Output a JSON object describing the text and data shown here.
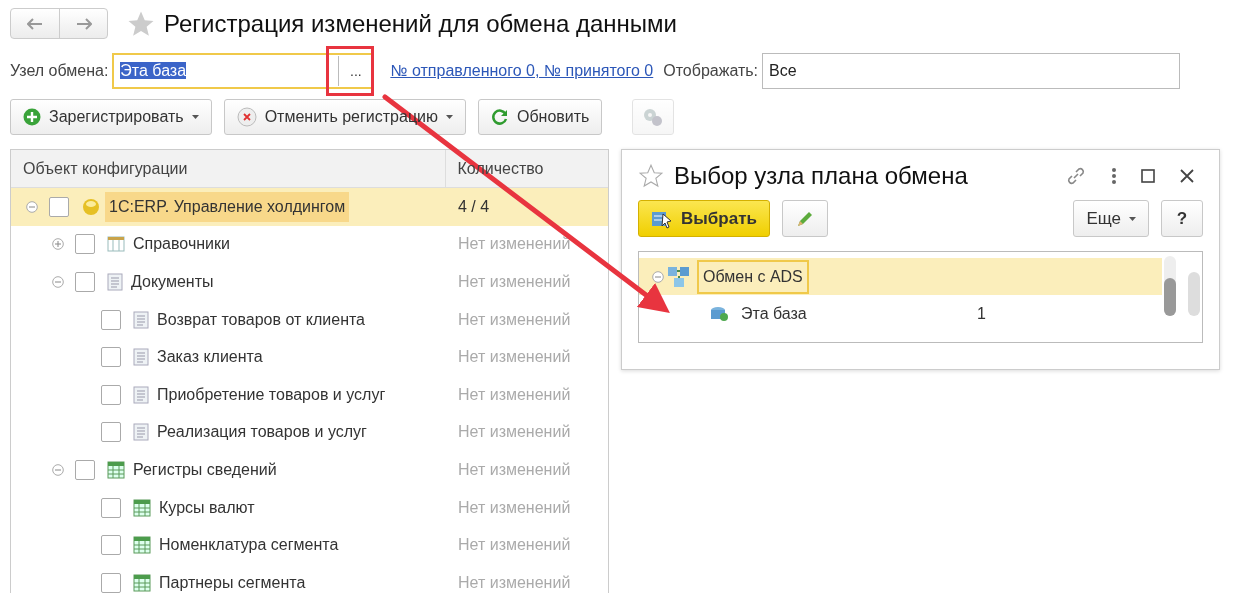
{
  "window": {
    "title": "Регистрация изменений для обмена данными",
    "favorite": false
  },
  "node_field": {
    "label": "Узел обмена:",
    "value": "Эта база",
    "select_button": "..."
  },
  "counters_link": "№ отправленного 0, № принятого 0",
  "display_field": {
    "label": "Отображать:",
    "value": "Все"
  },
  "toolbar": [
    {
      "kind": "register",
      "label": "Зарегистрировать",
      "dropdown": true,
      "disabled": false
    },
    {
      "kind": "unregister",
      "label": "Отменить регистрацию",
      "dropdown": true,
      "disabled": false
    },
    {
      "kind": "refresh",
      "label": "Обновить",
      "dropdown": false,
      "disabled": false
    },
    {
      "kind": "settings",
      "dropdown": false,
      "disabled": true
    }
  ],
  "table": {
    "columns": [
      "Объект конфигурации",
      "Количество"
    ],
    "rows": [
      {
        "kind": "root",
        "label": "1C:ERP. Управление холдингом",
        "count": "4 / 4",
        "checked": false,
        "selected": true,
        "expanded": true,
        "children": [
          {
            "kind": "catalog",
            "label": "Справочники",
            "count": "Нет изменений",
            "checked": false,
            "selected": false,
            "expanded": false
          },
          {
            "kind": "document",
            "label": "Документы",
            "count": "Нет изменений",
            "checked": false,
            "selected": false,
            "expanded": true,
            "children": [
              {
                "kind": "document",
                "label": "Возврат товаров от клиента",
                "count": "Нет изменений",
                "checked": false,
                "selected": false
              },
              {
                "kind": "document",
                "label": "Заказ клиента",
                "count": "Нет изменений",
                "checked": false,
                "selected": false
              },
              {
                "kind": "document",
                "label": "Приобретение товаров и услуг",
                "count": "Нет изменений",
                "checked": false,
                "selected": false
              },
              {
                "kind": "document",
                "label": "Реализация товаров и услуг",
                "count": "Нет изменений",
                "checked": false,
                "selected": false
              }
            ]
          },
          {
            "kind": "register",
            "label": "Регистры сведений",
            "count": "Нет изменений",
            "checked": false,
            "selected": false,
            "expanded": true,
            "children": [
              {
                "kind": "register",
                "label": "Курсы валют",
                "count": "Нет изменений",
                "checked": false,
                "selected": false
              },
              {
                "kind": "register",
                "label": "Номенклатура сегмента",
                "count": "Нет изменений",
                "checked": false,
                "selected": false
              },
              {
                "kind": "register",
                "label": "Партнеры сегмента",
                "count": "Нет изменений",
                "checked": false,
                "selected": false
              }
            ]
          }
        ]
      }
    ]
  },
  "dialog": {
    "title": "Выбор узла плана обмена",
    "favorite": false,
    "select_button": "Выбрать",
    "more_button": "Еще",
    "help_button": "?",
    "rows": [
      {
        "label": "Обмен с ADS",
        "selected": true,
        "expanded": true,
        "children": [
          {
            "label": "Эта база",
            "count": "1",
            "selected": false
          }
        ]
      }
    ]
  }
}
